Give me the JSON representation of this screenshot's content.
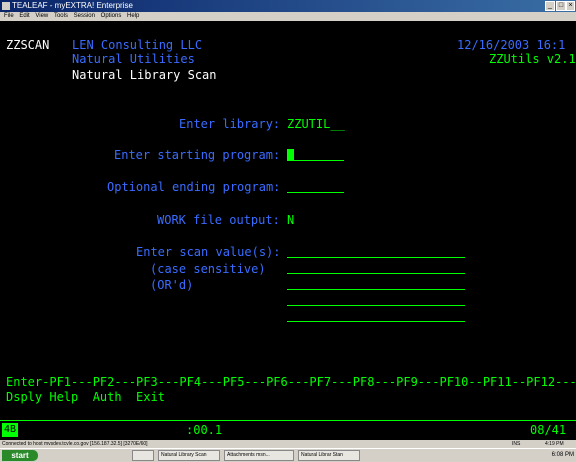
{
  "window": {
    "title": "TEALEAF - myEXTRA! Enterprise"
  },
  "menu": [
    "File",
    "Edit",
    "View",
    "Tools",
    "Session",
    "Options",
    "Help"
  ],
  "header": {
    "program_id": "ZZSCAN",
    "company": "LEN Consulting LLC",
    "date_time": "12/16/2003 16:1",
    "subtitle": "Natural Utilities",
    "version": "ZZUtils v2.1",
    "screen_title": "Natural Library Scan"
  },
  "form": {
    "library_label": "Enter library:",
    "library_value": "ZZUTIL__",
    "start_label": "Enter starting program:",
    "end_label": "Optional ending program:",
    "work_label": "WORK file output:",
    "work_value": "N",
    "scan_label": "Enter scan value(s):",
    "scan_note1": "(case sensitive)",
    "scan_note2": "(OR'd)"
  },
  "pfkeys_line1": "Enter-PF1---PF2---PF3---PF4---PF5---PF6---PF7---PF8---PF9---PF10--PF11--PF12---",
  "pfkeys_line2": "Dsply Help  Auth  Exit",
  "status": {
    "session": "4B",
    "elapsed": ":00.1",
    "cursor_pos": "08/41"
  },
  "infobar": {
    "connection": "Connected to host mvsdev.tcvle.co.gov [156.187.32.5] [3270E/60]",
    "mode": "INS",
    "time": "4:19 PM"
  },
  "taskbar": {
    "start": "start",
    "tasks": [
      "",
      "Natural Library Scan",
      "Attachments msn...",
      "Natural Librar Stan"
    ],
    "clock": "6:08 PM"
  }
}
